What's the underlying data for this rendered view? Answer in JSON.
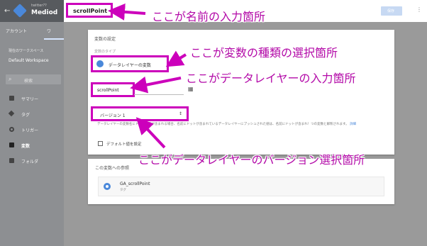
{
  "app": {
    "back_icon": "arrow-left-icon",
    "account_name": "twitter??",
    "container_name": "Mediod",
    "tabs": [
      "アカウント",
      "ワ"
    ],
    "workspace_label": "現在のワークスペース",
    "workspace_name": "Default Workspace",
    "search_placeholder": "検索"
  },
  "sidebar": {
    "items": [
      {
        "label": "サマリー",
        "icon": "folder-icon"
      },
      {
        "label": "タグ",
        "icon": "tag-icon"
      },
      {
        "label": "トリガー",
        "icon": "trigger-icon"
      },
      {
        "label": "変数",
        "icon": "variable-icon"
      },
      {
        "label": "フォルダ",
        "icon": "folder-icon"
      }
    ]
  },
  "header": {
    "variable_name": "scrollPoint",
    "save_label": "保存"
  },
  "config": {
    "title": "変数の設定",
    "type_label": "変数のタイプ",
    "type_value": "データレイヤーの変数",
    "dlv_value": "scrollPoint",
    "version_value": "バージョン 1",
    "description": "データレイヤーの変数名にドット記号が含まれる場合、名前にドットが含まれているデータレイヤーにプッシュされた値は、名前にドットが含まれ！つの変数と解釈されます。",
    "description_link": "詳細",
    "default_checkbox_label": "デフォルト値を設定"
  },
  "references": {
    "title": "この変数への参照",
    "item_name": "GA_scrollPoint",
    "item_type": "タグ"
  },
  "annotations": {
    "name": "ここが名前の入力箇所",
    "type": "ここが変数の種類の選択箇所",
    "dlv": "ここがデータレイヤーの入力箇所",
    "version": "ここがデータレイヤーのバージョン選択箇所"
  },
  "colors": {
    "highlight": "#cc00bb",
    "annotation_text": "#b30aa8",
    "accent": "#4a88da"
  }
}
